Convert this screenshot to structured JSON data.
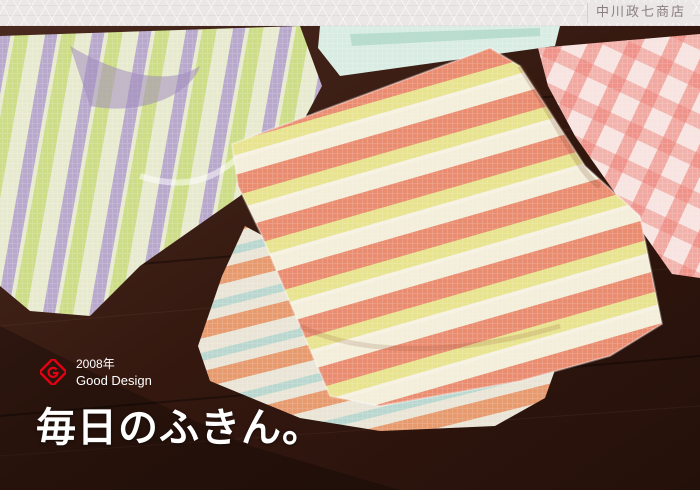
{
  "header": {
    "brand": "中川政七商店"
  },
  "badge": {
    "year": "2008年",
    "award": "Good Design",
    "logo_icon": "good-design-g-mark-icon",
    "logo_color": "#e60012"
  },
  "hero": {
    "headline": "毎日のふきん。"
  },
  "colors": {
    "wood": "#3a1e16",
    "coral": "#e98a73",
    "yellow": "#e6e68f",
    "lavender": "#b4a6c9",
    "pink": "#f0a9a3",
    "mint": "#a9d6c4"
  }
}
